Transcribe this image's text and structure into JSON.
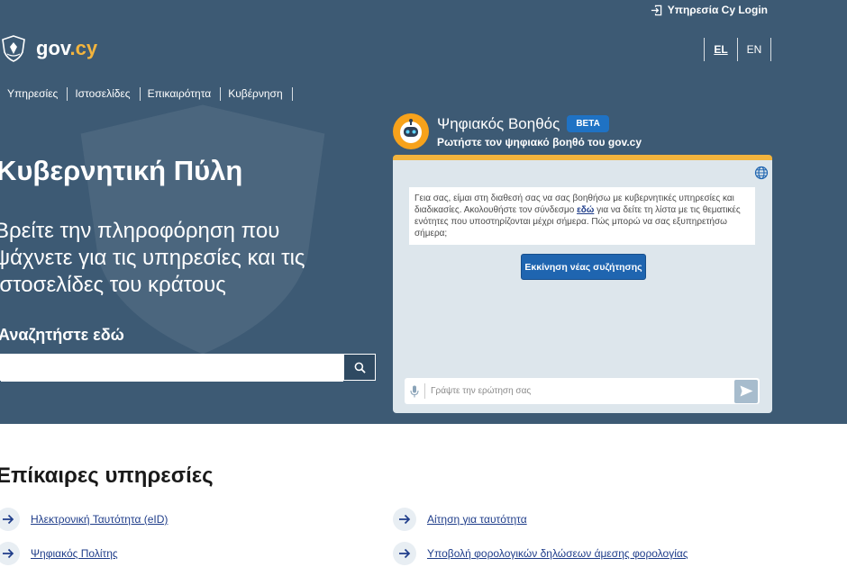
{
  "topbar": {
    "login_label": "Υπηρεσία Cy Login"
  },
  "logo": {
    "name": "gov",
    "dot": ".",
    "tld": "cy"
  },
  "languages": [
    {
      "code": "EL",
      "active": true
    },
    {
      "code": "EN",
      "active": false
    }
  ],
  "nav": [
    "Υπηρεσίες",
    "Ιστοσελίδες",
    "Επικαιρότητα",
    "Κυβέρνηση"
  ],
  "hero": {
    "title": "Κυβερνητική Πύλη",
    "subtitle": "Βρείτε την πληροφόρηση που ψάχνετε για τις υπηρεσίες και τις ιστοσελίδες του κράτους",
    "search_label": "Αναζητήστε εδώ"
  },
  "chatbot": {
    "title": "Ψηφιακός Βοηθός",
    "badge": "BETA",
    "subtitle": "Ρωτήστε τον ψηφιακό βοηθό του gov.cy",
    "message_before": "Γεια σας, είμαι στη διαθεσή σας να σας βοηθήσω με κυβερνητικές υπηρεσίες και διαδικασίες. Ακολουθήστε τον σύνδεσμο ",
    "message_link": "εδώ",
    "message_after": " για να δείτε τη λίστα με τις θεματικές ενότητες που υποστηρίζονται μέχρι σήμερα. Πώς μπορώ να σας εξυπηρετήσω σήμερα;",
    "new_chat_label": "Εκκίνηση νέας συζήτησης",
    "input_placeholder": "Γράψτε την ερώτηση σας"
  },
  "services": {
    "title": "Επίκαιρες υπηρεσίες",
    "items": [
      "Ηλεκτρονική Ταυτότητα (eID)",
      "Αίτηση για ταυτότητα",
      "Ψηφιακός Πολίτης",
      "Υποβολή φορολογικών δηλώσεων άμεσης φορολογίας"
    ]
  },
  "colors": {
    "hero_bg": "#3d5a74",
    "accent_yellow": "#f3b43d",
    "button_blue": "#1f65b0",
    "link_blue": "#1f3d8a"
  },
  "icons": [
    "login-icon",
    "cyprus-emblem-icon",
    "search-icon",
    "robot-avatar-icon",
    "globe-icon",
    "microphone-icon",
    "send-icon",
    "arrow-right-icon"
  ]
}
